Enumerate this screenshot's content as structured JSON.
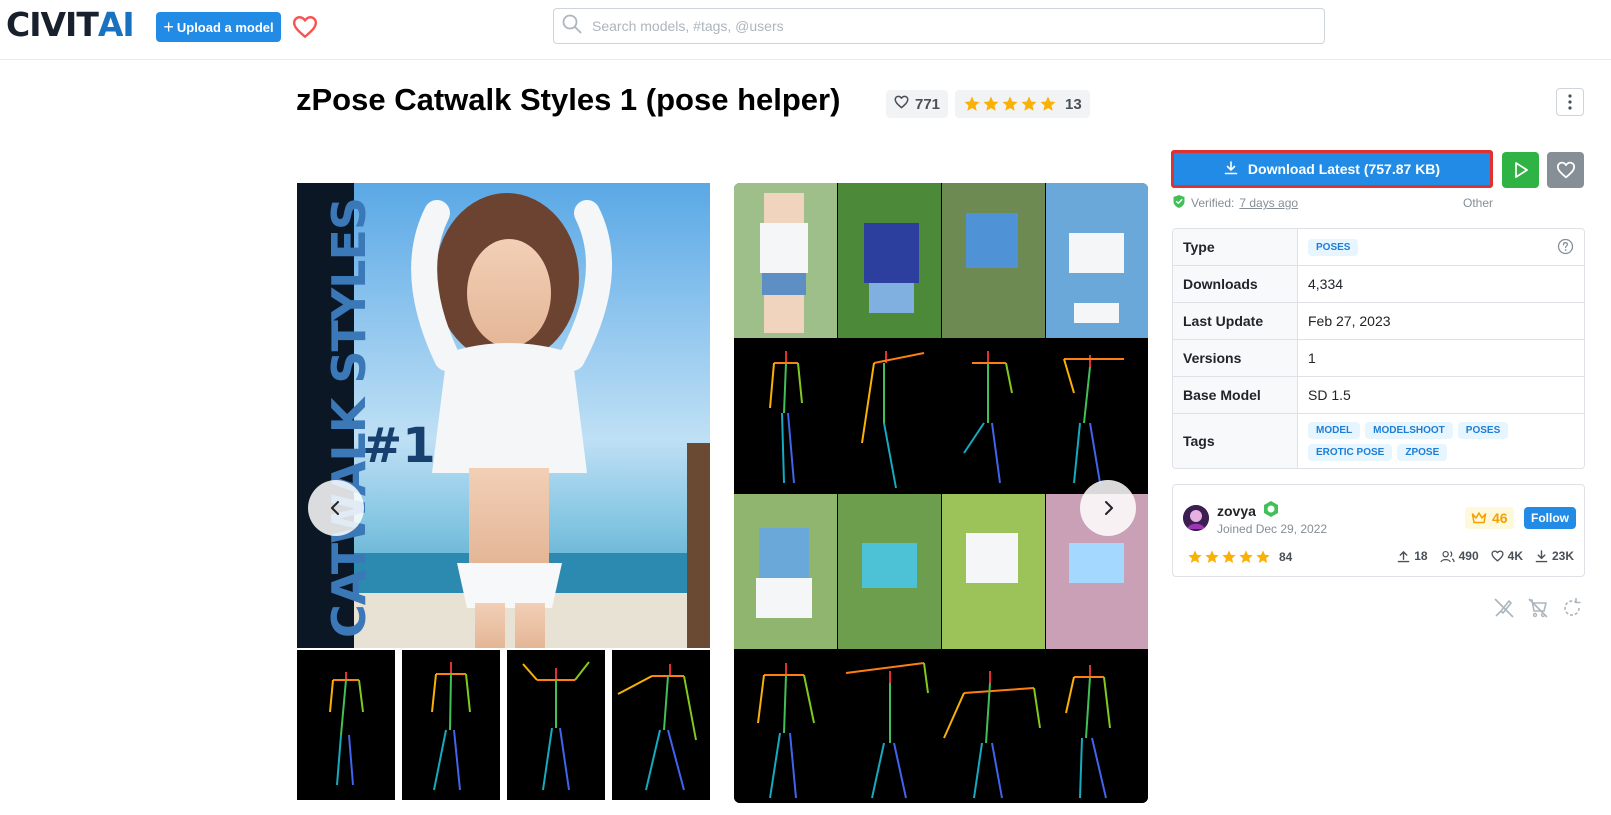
{
  "header": {
    "logo_text_dark": "CIVIT",
    "logo_text_blue": "AI",
    "upload_label": "Upload a model",
    "search_placeholder": "Search models, #tags, @users"
  },
  "model": {
    "title": "zPose Catwalk Styles 1 (pose helper)",
    "likes": "771",
    "rating_count": "13",
    "rating_stars": 5
  },
  "actions": {
    "download_label": "Download Latest (757.87 KB)",
    "verified_prefix": "Verified:",
    "verified_time": "7 days ago",
    "license_label": "Other"
  },
  "details": {
    "rows": [
      {
        "label": "Type",
        "value": "POSES"
      },
      {
        "label": "Downloads",
        "value": "4,334"
      },
      {
        "label": "Last Update",
        "value": "Feb 27, 2023"
      },
      {
        "label": "Versions",
        "value": "1"
      },
      {
        "label": "Base Model",
        "value": "SD 1.5"
      },
      {
        "label": "Tags",
        "value": ""
      }
    ],
    "tags": [
      "MODEL",
      "MODELSHOOT",
      "POSES",
      "EROTIC POSE",
      "ZPOSE"
    ]
  },
  "creator": {
    "name": "zovya",
    "joined": "Joined Dec 29, 2022",
    "rank": "46",
    "follow_label": "Follow",
    "rating_count": "84",
    "stats": {
      "uploads": "18",
      "followers": "490",
      "likes": "4K",
      "downloads": "23K"
    }
  },
  "gallery": {
    "cover_text_vertical": "CATWALK STYLES",
    "cover_text_number": "#1"
  },
  "colors": {
    "primary": "#228be6",
    "success": "#2fb344",
    "star": "#fab005",
    "highlight_border": "#e03131"
  }
}
